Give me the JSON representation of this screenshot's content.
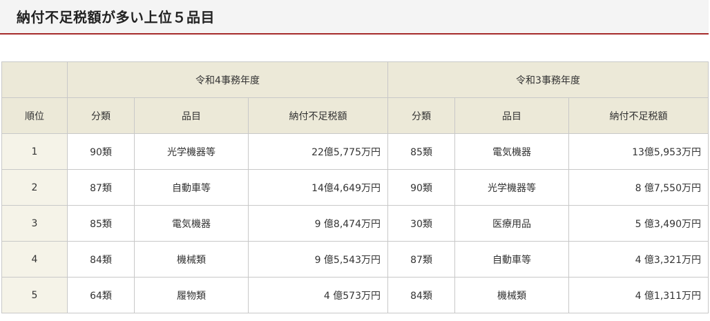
{
  "title": "納付不足税額が多い上位５品目",
  "table": {
    "rank_header": "順位",
    "periods": [
      "令和4事務年度",
      "令和3事務年度"
    ],
    "sub_headers": {
      "category": "分類",
      "item": "品目",
      "amount": "納付不足税額"
    },
    "rows": [
      {
        "rank": "1",
        "r4_cat": "90類",
        "r4_item": "光学機器等",
        "r4_amount": "22億5,775万円",
        "r3_cat": "85類",
        "r3_item": "電気機器",
        "r3_amount": "13億5,953万円"
      },
      {
        "rank": "2",
        "r4_cat": "87類",
        "r4_item": "自動車等",
        "r4_amount": "14億4,649万円",
        "r3_cat": "90類",
        "r3_item": "光学機器等",
        "r3_amount": "8 億7,550万円"
      },
      {
        "rank": "3",
        "r4_cat": "85類",
        "r4_item": "電気機器",
        "r4_amount": "9 億8,474万円",
        "r3_cat": "30類",
        "r3_item": "医療用品",
        "r3_amount": "5 億3,490万円"
      },
      {
        "rank": "4",
        "r4_cat": "84類",
        "r4_item": "機械類",
        "r4_amount": "9 億5,543万円",
        "r3_cat": "87類",
        "r3_item": "自動車等",
        "r3_amount": "4 億3,321万円"
      },
      {
        "rank": "5",
        "r4_cat": "64類",
        "r4_item": "履物類",
        "r4_amount": "4 億573万円",
        "r3_cat": "84類",
        "r3_item": "機械類",
        "r3_amount": "4 億1,311万円"
      }
    ]
  }
}
